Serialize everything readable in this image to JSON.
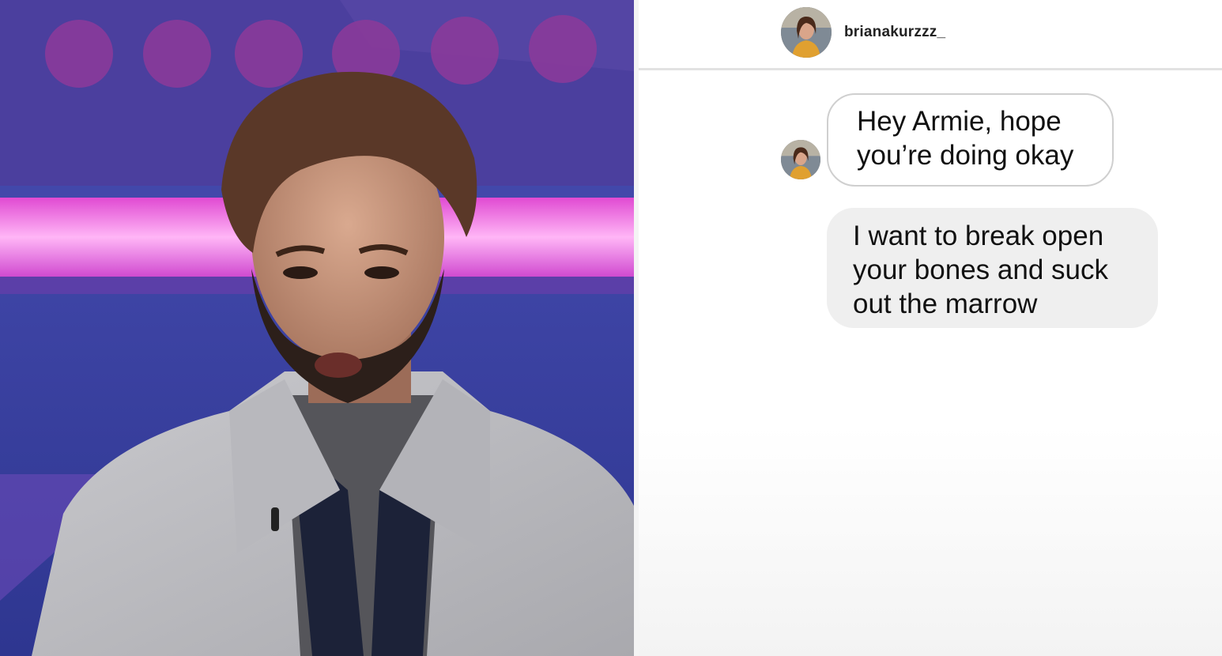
{
  "video": {
    "description_icon": "person-portrait"
  },
  "chat": {
    "header": {
      "username": "brianakurzzz_"
    },
    "messages": [
      {
        "direction": "incoming",
        "text": "Hey Armie, hope you’re doing okay"
      },
      {
        "direction": "outgoing",
        "text": "I want to break open your bones and suck out the marrow"
      }
    ]
  },
  "colors": {
    "studio_blue": "#3a3fa0",
    "neon_pink": "#ff6fe8",
    "incoming_border": "#cfcfcf",
    "outgoing_bg": "#efefef"
  }
}
